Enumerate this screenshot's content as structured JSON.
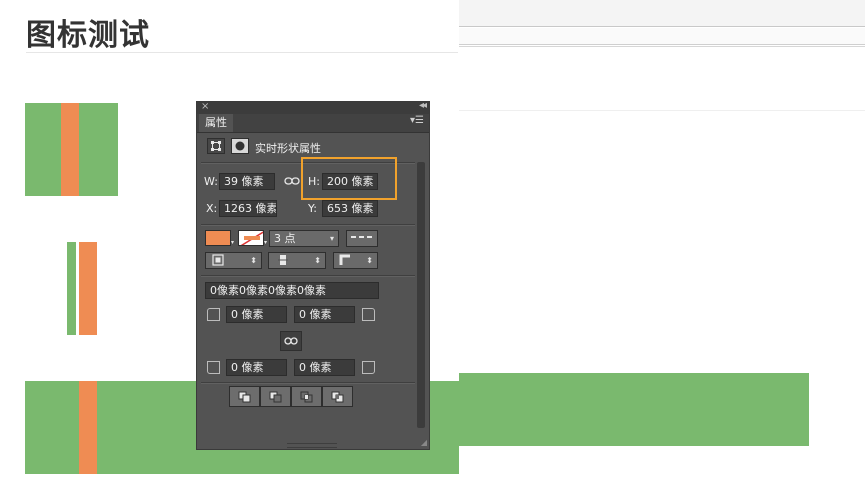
{
  "page": {
    "title": "图标测试"
  },
  "panel": {
    "close_glyph": "×",
    "collapse_glyph": "◂◂",
    "tab_label": "属性",
    "tab_menu_glyph": "▾☰",
    "header_label": "实时形状属性",
    "size": {
      "w_label": "W:",
      "w_value": "39 像素",
      "h_label": "H:",
      "h_value": "200 像素",
      "x_label": "X:",
      "x_value": "1263 像素",
      "y_label": "Y:",
      "y_value": "653 像素"
    },
    "stroke": {
      "fill_color": "#ef8c53",
      "width_value": "3 点"
    },
    "radius": {
      "combined_value": "0像素0像素0像素0像素",
      "top_left": "0 像素",
      "top_right": "0 像素",
      "bottom_left": "0 像素",
      "bottom_right": "0 像素"
    }
  },
  "colors": {
    "green_shape": "#7ab96e",
    "orange_shape": "#ef8c53",
    "highlight": "#f1a22c",
    "panel_bg": "#535353"
  }
}
